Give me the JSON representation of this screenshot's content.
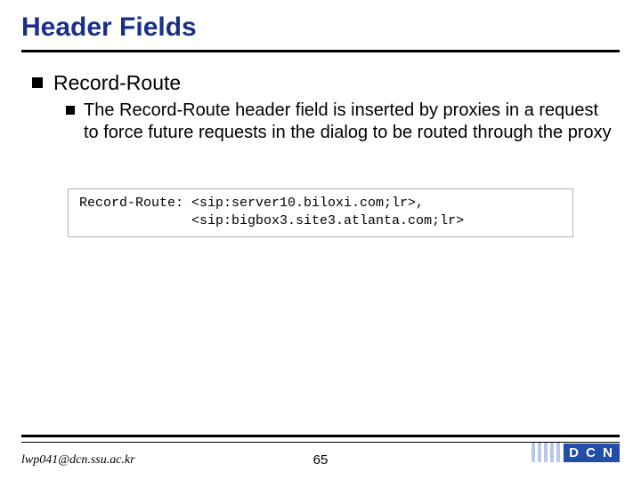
{
  "title": "Header Fields",
  "bullets": {
    "level1": "Record-Route",
    "level2": "The Record-Route header field is inserted by proxies in a request to force future requests in the dialog to be routed through the proxy"
  },
  "code": "Record-Route: <sip:server10.biloxi.com;lr>,\n              <sip:bigbox3.site3.atlanta.com;lr>",
  "footer": {
    "email": "lwp041@dcn.ssu.ac.kr",
    "page": "65",
    "logo": "D C N"
  }
}
